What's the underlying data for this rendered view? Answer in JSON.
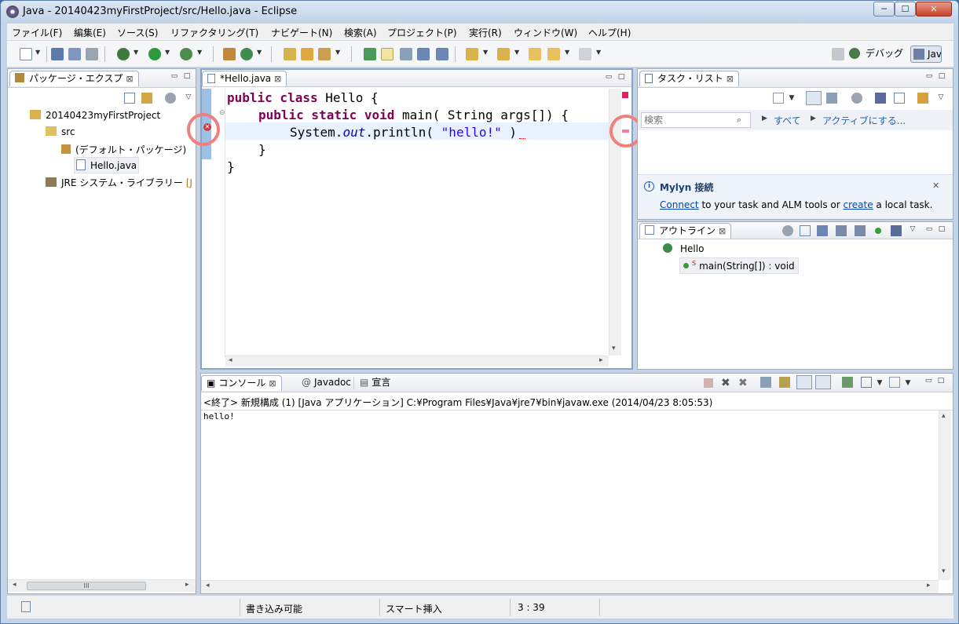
{
  "window": {
    "title": "Java - 20140423myFirstProject/src/Hello.java - Eclipse",
    "min_label": "─",
    "max_label": "☐",
    "close_label": "✕"
  },
  "menubar": {
    "items": [
      "ファイル(F)",
      "編集(E)",
      "ソース(S)",
      "リファクタリング(T)",
      "ナビゲート(N)",
      "検索(A)",
      "プロジェクト(P)",
      "実行(R)",
      "ウィンドウ(W)",
      "ヘルプ(H)"
    ]
  },
  "perspectives": {
    "debug": "デバッグ",
    "java": "Jav"
  },
  "package_explorer": {
    "tab_label": "パッケージ・エクスプ",
    "close": "⊠",
    "tree": {
      "project": "20140423myFirstProject",
      "src": "src",
      "default_package": "(デフォルト・パッケージ)",
      "file": "Hello.java",
      "jre": "JRE システム・ライブラリー",
      "jre_suffix": "[J"
    },
    "hscroll_thumb": "III"
  },
  "editor": {
    "tab_label": "*Hello.java",
    "close": "⊠",
    "lines": {
      "l1_kw": "public class ",
      "l1_rest": "Hello {",
      "l2_kw": "public static void ",
      "l2_rest": "main( String args[]) {",
      "l3_pre": "System.",
      "l3_field": "out",
      "l3_mid": ".println( ",
      "l3_str": "\"hello!\"",
      "l3_post": " )",
      "l4": "}",
      "l5": "}"
    },
    "error_marker": "✕"
  },
  "task_list": {
    "tab_label": "タスク・リスト",
    "close": "⊠",
    "search_placeholder": "検索",
    "all_link": "すべて",
    "activate_link": "アクティブにする..."
  },
  "mylyn": {
    "title": "Mylyn 接続",
    "connect": "Connect",
    "middle": " to your task and ALM tools or ",
    "create": "create",
    "end": " a local task.",
    "close": "✕"
  },
  "outline": {
    "tab_label": "アウトライン",
    "close": "⊠",
    "class_name": "Hello",
    "method": "main(String[]) : void",
    "static_marker": "S"
  },
  "console": {
    "tabs": [
      "コンソール",
      "Javadoc",
      "宣言"
    ],
    "tab_icons": [
      "▣",
      "@",
      "▤"
    ],
    "close": "⊠",
    "header": "<終了> 新規構成 (1) [Java アプリケーション] C:¥Program Files¥Java¥jre7¥bin¥javaw.exe (2014/04/23 8:05:53)",
    "output": "hello!"
  },
  "statusbar": {
    "writable": "書き込み可能",
    "insert_mode": "スマート挿入",
    "position": "3 : 39"
  },
  "colors": {
    "keyword": "#7f0055",
    "string": "#2a00ff",
    "field": "#0000c0",
    "error_circle": "#f08080",
    "link": "#0645ad"
  }
}
